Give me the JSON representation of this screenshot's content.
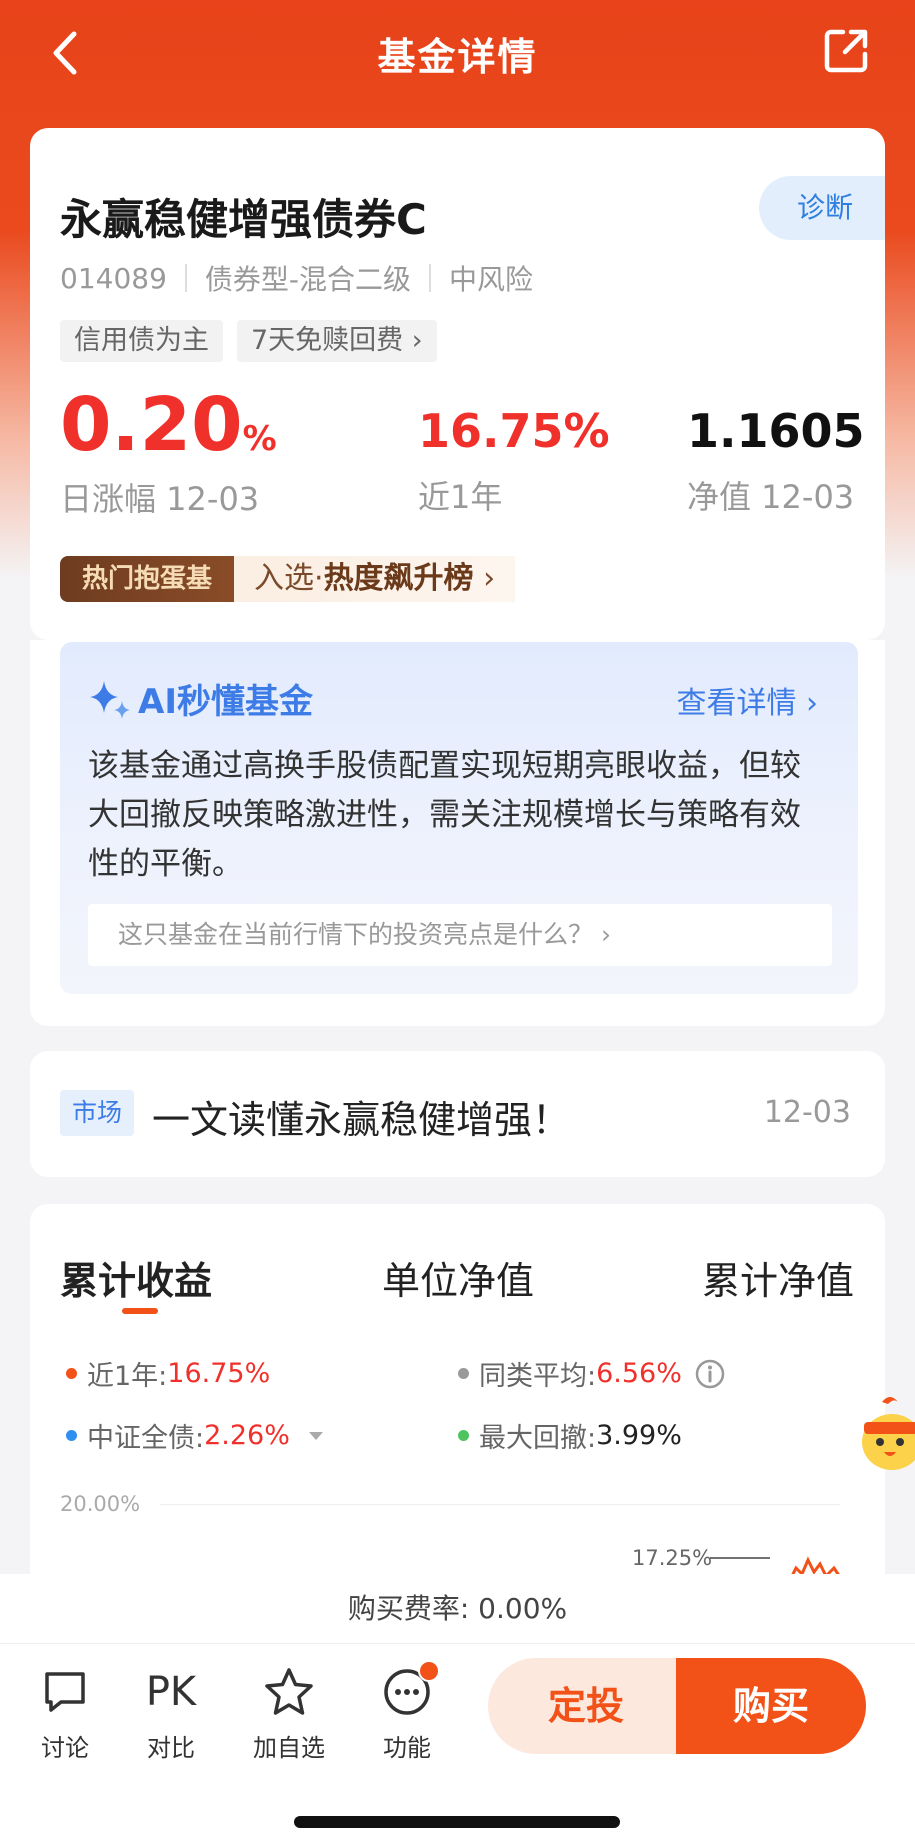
{
  "nav": {
    "title": "基金详情",
    "back_icon": "chevron-left-icon",
    "share_icon": "share-icon"
  },
  "fund": {
    "name": "永赢稳健增强债券C",
    "diagnose_label": "诊断",
    "code": "014089",
    "category": "债券型-混合二级",
    "risk": "中风险",
    "tags": [
      "信用债为主",
      "7天免赎回费 ›"
    ],
    "daily_change": {
      "value": "0.20",
      "unit": "%",
      "label": "日涨幅 12-03"
    },
    "one_year": {
      "value": "16.75%",
      "label": "近1年"
    },
    "nav_value": {
      "value": "1.1605",
      "label": "净值 12-03"
    },
    "hot_badge": "热门抱蛋基",
    "hot_text_prefix": "入选·",
    "hot_text_bold": "热度飙升榜",
    "hot_arrow": "›"
  },
  "ai": {
    "title": "AI秒懂基金",
    "link": "查看详情 ›",
    "description": "该基金通过高换手股债配置实现短期亮眼收益，但较大回撤反映策略激进性，需关注规模增长与策略有效性的平衡。",
    "question": "这只基金在当前行情下的投资亮点是什么？ ›"
  },
  "news": {
    "tag": "市场",
    "title": "一文读懂永赢稳健增强！",
    "date": "12-03"
  },
  "chart_section": {
    "tabs": [
      "累计收益",
      "单位净值",
      "累计净值"
    ],
    "active_tab": 0,
    "legend": [
      {
        "label": "近1年:",
        "value": "16.75%",
        "color": "#f25218"
      },
      {
        "label": "同类平均:",
        "value": "6.56%",
        "color": "#999999"
      },
      {
        "label": "中证全债:",
        "value": "2.26%",
        "color": "#2f8ff0"
      },
      {
        "label": "最大回撤:",
        "value": "3.99%",
        "color": "#4fc35f"
      }
    ],
    "y_label_top": "20.00%",
    "peak_label": "17.25%"
  },
  "bottom": {
    "fee_text": "购买费率: 0.00%",
    "items": [
      {
        "label": "讨论",
        "icon": "chat-bubble-icon"
      },
      {
        "label": "对比",
        "icon_text": "PK"
      },
      {
        "label": "加自选",
        "icon": "star-icon"
      },
      {
        "label": "功能",
        "icon": "more-icon"
      }
    ],
    "dingtou_label": "定投",
    "buy_label": "购买"
  }
}
